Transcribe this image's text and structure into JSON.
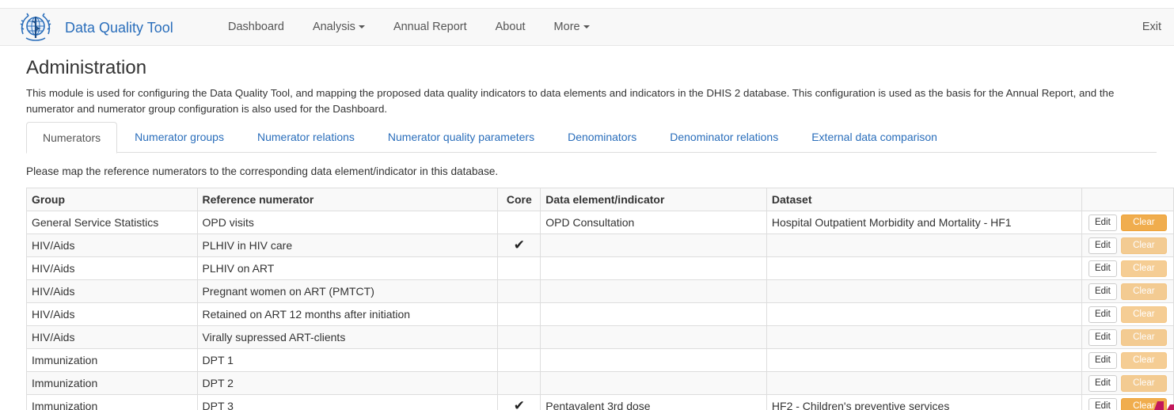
{
  "navbar": {
    "brand": "Data Quality Tool",
    "logo_icon": "who-emblem-icon",
    "links": [
      "Dashboard",
      "Analysis",
      "Annual Report",
      "About",
      "More"
    ],
    "exit": "Exit"
  },
  "page": {
    "title": "Administration",
    "intro": "This module is used for configuring the Data Quality Tool, and mapping the proposed data quality indicators to data elements and indicators in the DHIS 2 database. This configuration is used as the basis for the Annual Report, and the numerator and numerator group configuration is also used for the Dashboard."
  },
  "tabs": [
    "Numerators",
    "Numerator groups",
    "Numerator relations",
    "Numerator quality parameters",
    "Denominators",
    "Denominator relations",
    "External data comparison"
  ],
  "active_tab": "Numerators",
  "instruction": "Please map the reference numerators to the corresponding data element/indicator in this database.",
  "table": {
    "headers": [
      "Group",
      "Reference numerator",
      "Core",
      "Data element/indicator",
      "Dataset",
      ""
    ],
    "edit_label": "Edit",
    "clear_label": "Clear",
    "core_icon": "checkmark-icon",
    "rows": [
      {
        "group": "General Service Statistics",
        "numerator": "OPD visits",
        "core": false,
        "data_element": "OPD Consultation",
        "dataset": "Hospital Outpatient Morbidity and Mortality - HF1",
        "clear_enabled": true
      },
      {
        "group": "HIV/Aids",
        "numerator": "PLHIV in HIV care",
        "core": true,
        "data_element": "",
        "dataset": "",
        "clear_enabled": false
      },
      {
        "group": "HIV/Aids",
        "numerator": "PLHIV on ART",
        "core": false,
        "data_element": "",
        "dataset": "",
        "clear_enabled": false
      },
      {
        "group": "HIV/Aids",
        "numerator": "Pregnant women on ART (PMTCT)",
        "core": false,
        "data_element": "",
        "dataset": "",
        "clear_enabled": false
      },
      {
        "group": "HIV/Aids",
        "numerator": "Retained on ART 12 months after initiation",
        "core": false,
        "data_element": "",
        "dataset": "",
        "clear_enabled": false
      },
      {
        "group": "HIV/Aids",
        "numerator": "Virally supressed ART-clients",
        "core": false,
        "data_element": "",
        "dataset": "",
        "clear_enabled": false
      },
      {
        "group": "Immunization",
        "numerator": "DPT 1",
        "core": false,
        "data_element": "",
        "dataset": "",
        "clear_enabled": false
      },
      {
        "group": "Immunization",
        "numerator": "DPT 2",
        "core": false,
        "data_element": "",
        "dataset": "",
        "clear_enabled": false
      },
      {
        "group": "Immunization",
        "numerator": "DPT 3",
        "core": true,
        "data_element": "Pentavalent 3rd dose",
        "dataset": "HF2 - Children's preventive services",
        "clear_enabled": true
      }
    ]
  },
  "colors": {
    "link": "#2a6ebb",
    "clear_button": "#f0ad4e",
    "corner_mark": "#c2185b"
  }
}
